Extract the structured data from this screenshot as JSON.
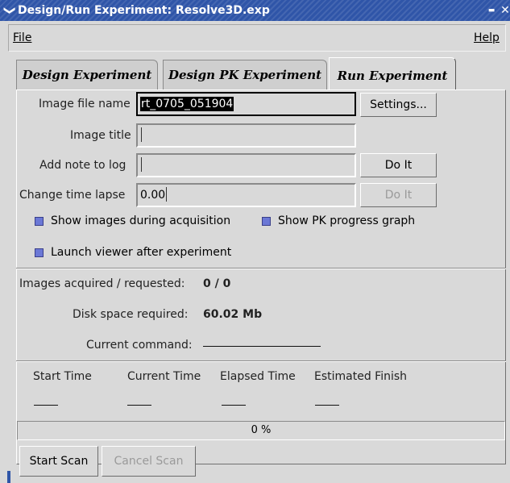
{
  "window": {
    "title": "Design/Run Experiment: Resolve3D.exp",
    "menu_glyph": "❯",
    "minimize_glyph": "▬",
    "close_glyph": "✕"
  },
  "menubar": {
    "file": "File",
    "help": "Help"
  },
  "tabs": [
    {
      "label": "Design Experiment",
      "active": false
    },
    {
      "label": "Design PK Experiment",
      "active": false
    },
    {
      "label": "Run Experiment",
      "active": true
    }
  ],
  "form": {
    "image_file_name_label": "Image file name",
    "image_file_name_value": "rt_0705_051904",
    "settings_button": "Settings...",
    "image_title_label": "Image title",
    "image_title_value": "",
    "add_note_label": "Add note to log",
    "add_note_value": "",
    "do_it_button": "Do It",
    "change_time_lapse_label": "Change time lapse",
    "change_time_lapse_value": "0.00",
    "do_it_button_2": "Do It"
  },
  "checkboxes": {
    "show_images": "Show images during acquisition",
    "show_pk": "Show PK progress graph",
    "launch_viewer": "Launch viewer after experiment",
    "checked_color": "#6b78d6"
  },
  "status": {
    "images_label": "Images acquired / requested:",
    "images_value": "0 / 0",
    "disk_label": "Disk space required:",
    "disk_value": "60.02 Mb",
    "command_label": "Current command:"
  },
  "times": {
    "start": "Start Time",
    "current": "Current Time",
    "elapsed": "Elapsed Time",
    "finish": "Estimated Finish"
  },
  "progress": {
    "text": "0 %",
    "fraction": 0
  },
  "actions": {
    "start_scan": "Start Scan",
    "cancel_scan": "Cancel Scan"
  },
  "colors": {
    "titlebar": "#2f55a8",
    "background": "#d9d9d9"
  }
}
